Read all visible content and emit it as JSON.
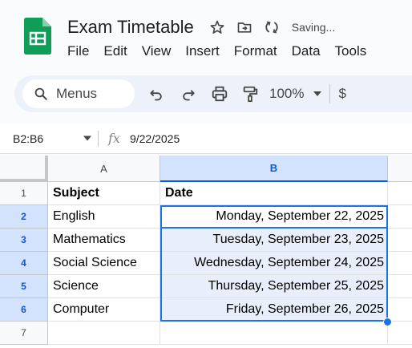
{
  "app": {
    "doc_title": "Exam Timetable",
    "status": "Saving...",
    "brand_color": "#0f9d58",
    "accent_color": "#0b57d0"
  },
  "menu": [
    "File",
    "Edit",
    "View",
    "Insert",
    "Format",
    "Data",
    "Tools"
  ],
  "toolbar": {
    "search_label": "Menus",
    "zoom": "100%",
    "currency": "$"
  },
  "formula_bar": {
    "name_box": "B2:B6",
    "value": "9/22/2025"
  },
  "grid": {
    "columns": [
      "A",
      "B"
    ],
    "row_numbers": [
      "1",
      "2",
      "3",
      "4",
      "5",
      "6",
      "7"
    ],
    "header_row": {
      "a": "Subject",
      "b": "Date"
    },
    "rows": [
      {
        "subject": "English",
        "date": "Monday, September 22, 2025"
      },
      {
        "subject": "Mathematics",
        "date": "Tuesday, September 23, 2025"
      },
      {
        "subject": "Social Science",
        "date": "Wednesday, September 24, 2025"
      },
      {
        "subject": "Science",
        "date": "Thursday, September 25, 2025"
      },
      {
        "subject": "Computer",
        "date": "Friday, September 26, 2025"
      }
    ]
  },
  "icons": {
    "star": "star-icon",
    "move": "move-to-folder-icon",
    "sync": "cloud-sync-icon",
    "search": "search-icon",
    "undo": "undo-icon",
    "redo": "redo-icon",
    "print": "print-icon",
    "paint_format": "paint-format-icon",
    "dropdown": "chevron-down-icon",
    "fx": "function-icon"
  }
}
